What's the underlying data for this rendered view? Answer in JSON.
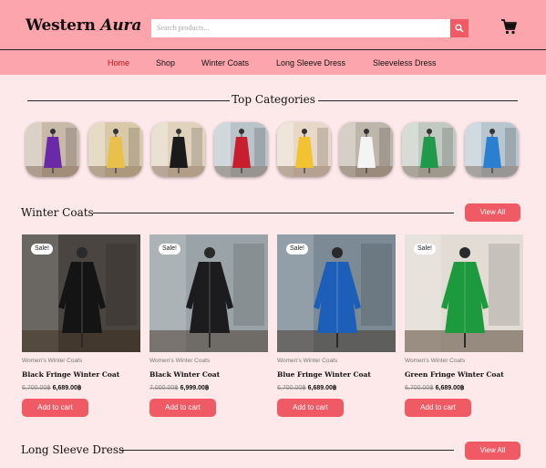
{
  "header": {
    "logo_part1": "Western ",
    "logo_part2": "Aura",
    "search_placeholder": "Search products..."
  },
  "nav": {
    "items": [
      "Home",
      "Shop",
      "Winter Coats",
      "Long Sleeve Dress",
      "Sleeveless Dress"
    ],
    "active": "Home"
  },
  "top_categories": {
    "title": "Top Categories",
    "count": 8
  },
  "winter_coats": {
    "title": "Winter Coats",
    "view_all": "View All",
    "products": [
      {
        "badge": "Sale!",
        "category": "Women's Winter Coats",
        "name": "Black Fringe Winter Coat",
        "old_price": "6,700.00฿",
        "new_price": "6,689.00฿",
        "button": "Add to cart"
      },
      {
        "badge": "Sale!",
        "category": "Women's Winter Coats",
        "name": "Black Winter Coat",
        "old_price": "7,000.00฿",
        "new_price": "6,999.00฿",
        "button": "Add to cart"
      },
      {
        "badge": "Sale!",
        "category": "Women's Winter Coats",
        "name": "Blue Fringe Winter Coat",
        "old_price": "6,700.00฿",
        "new_price": "6,689.00฿",
        "button": "Add to cart"
      },
      {
        "badge": "Sale!",
        "category": "Women's Winter Coats",
        "name": "Green Fringe Winter Coat",
        "old_price": "6,700.00฿",
        "new_price": "6,689.00฿",
        "button": "Add to cart"
      }
    ]
  },
  "long_sleeve": {
    "title": "Long Sleeve Dress",
    "view_all": "View All"
  },
  "colors": {
    "header_bg": "#fca5ad",
    "page_bg": "#fde8ea",
    "accent": "#f05a64",
    "active_nav": "#c0141e"
  },
  "icons": {
    "search": "search-icon",
    "cart": "cart-icon"
  }
}
